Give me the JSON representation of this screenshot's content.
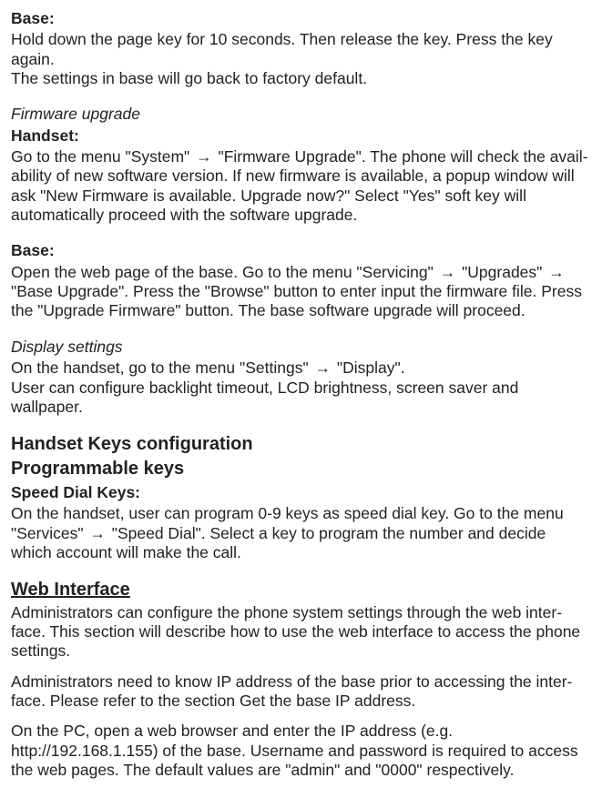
{
  "s1": {
    "head": "Base:",
    "p1a": "Hold down the page key for 10 seconds. Then release the key. Press the key again.",
    "p1b": "The settings in base will go back to factory default."
  },
  "s2": {
    "italicHead": "Firmware upgrade",
    "handsetLabel": "Handset:",
    "l1a": "Go to the menu \"System\" ",
    "l1b": " \"Firmware Upgrade\". The phone will check the avail-",
    "l2": "ability of new software version. If new firmware is available, a popup window will",
    "l3": "ask \"New Firmware is available. Upgrade now?\" Select \"Yes\" soft key will",
    "l4": "automatically proceed with the software upgrade."
  },
  "s3": {
    "head": "Base:",
    "l1a": "Open the web page of the base. Go to the menu \"Servicing\" ",
    "l1b": " \"Upgrades\" ",
    "l2": "\"Base Upgrade\". Press the \"Browse\" button to enter input the firmware file. Press",
    "l3": "the \"Upgrade Firmware\" button. The base software upgrade will proceed."
  },
  "s4": {
    "italicHead": "Display settings",
    "l1a": "On the handset, go to the menu \"Settings\" ",
    "l1b": " \"Display\".",
    "l2": "User can configure backlight timeout, LCD brightness, screen saver and wallpaper."
  },
  "s5": {
    "h1": "Handset Keys configuration",
    "h2": "Programmable keys",
    "sub": "Speed Dial Keys:",
    "l1": "On the handset, user can program 0-9 keys as speed dial key. Go to the menu",
    "l2a": "\"Services\" ",
    "l2b": " \"Speed Dial\". Select a key to program the number and decide",
    "l3": "which account will make the call."
  },
  "s6": {
    "h": "Web Interface",
    "p1l1": "Administrators can configure the phone system settings through the web inter-",
    "p1l2": "face. This section will describe how to use the web interface to access the phone",
    "p1l3": "settings.",
    "p2l1": "Administrators need to know IP address of the base prior to accessing the inter-",
    "p2l2": "face. Please refer to the section Get the base IP address.",
    "p3l1": "On the PC, open a web browser and enter the IP address (e.g.",
    "p3l2": "http://192.168.1.155) of the base. Username and password is required to access",
    "p3l3": "the web pages. The default values are \"admin\" and \"0000\" respectively."
  },
  "arrow": "→"
}
